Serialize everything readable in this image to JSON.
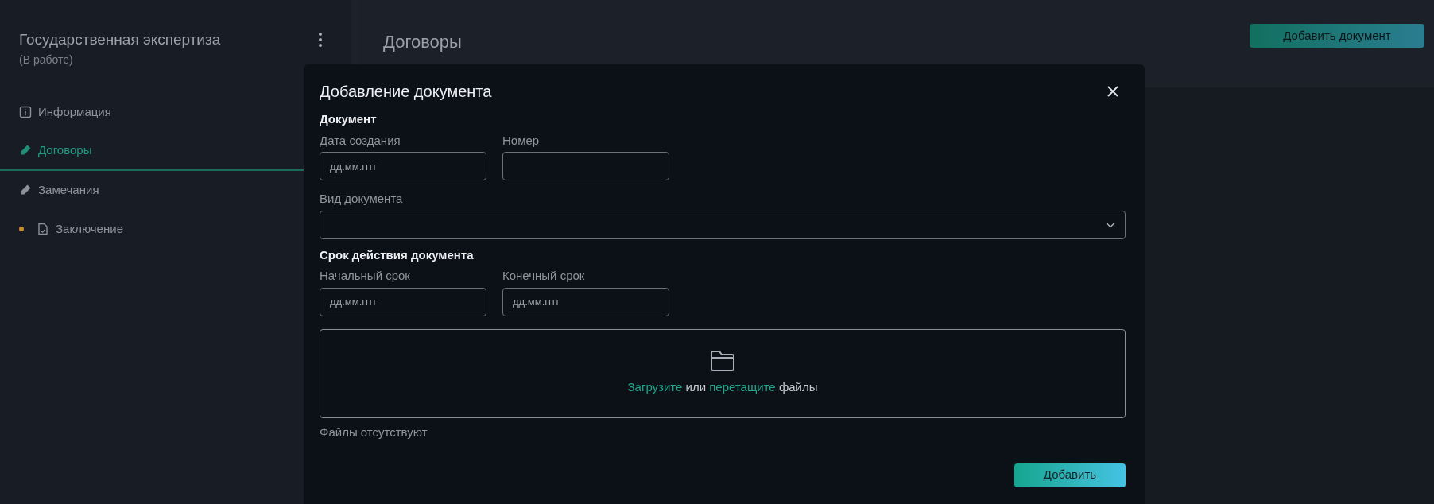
{
  "sidebar": {
    "title": "Государственная экспертиза",
    "status": "(В работе)",
    "items": [
      {
        "label": "Информация",
        "kind": "info",
        "selected": false
      },
      {
        "label": "Договоры",
        "kind": "edit",
        "selected": true
      },
      {
        "label": "Замечания",
        "kind": "edit",
        "selected": false
      },
      {
        "label": "Заключение",
        "kind": "document",
        "selected": false,
        "color": "#c98a2e"
      }
    ]
  },
  "main": {
    "title": "Договоры",
    "add_button": "Добавить документ"
  },
  "dialog": {
    "title": "Добавление документа",
    "sections": [
      {
        "heading": "Документ",
        "rows": [
          [
            {
              "kind": "input",
              "label": "Дата создания",
              "placeholder": "дд.мм.гггг"
            },
            {
              "kind": "input",
              "label": "Номер"
            }
          ],
          [
            {
              "kind": "select",
              "label": "Вид документа"
            }
          ]
        ]
      },
      {
        "heading": "Срок действия документа",
        "rows": [
          [
            {
              "kind": "input",
              "label": "Начальный срок",
              "placeholder": "дд.мм.гггг"
            },
            {
              "kind": "input",
              "label": "Конечный срок",
              "placeholder": "дд.мм.гггг"
            }
          ]
        ]
      }
    ],
    "dropzone": {
      "upload_link": "Загрузите",
      "or": "или",
      "drag_link": "перетащите",
      "files": "файлы"
    },
    "files_status": "Файлы отсутствуют",
    "submit": "Добавить"
  }
}
